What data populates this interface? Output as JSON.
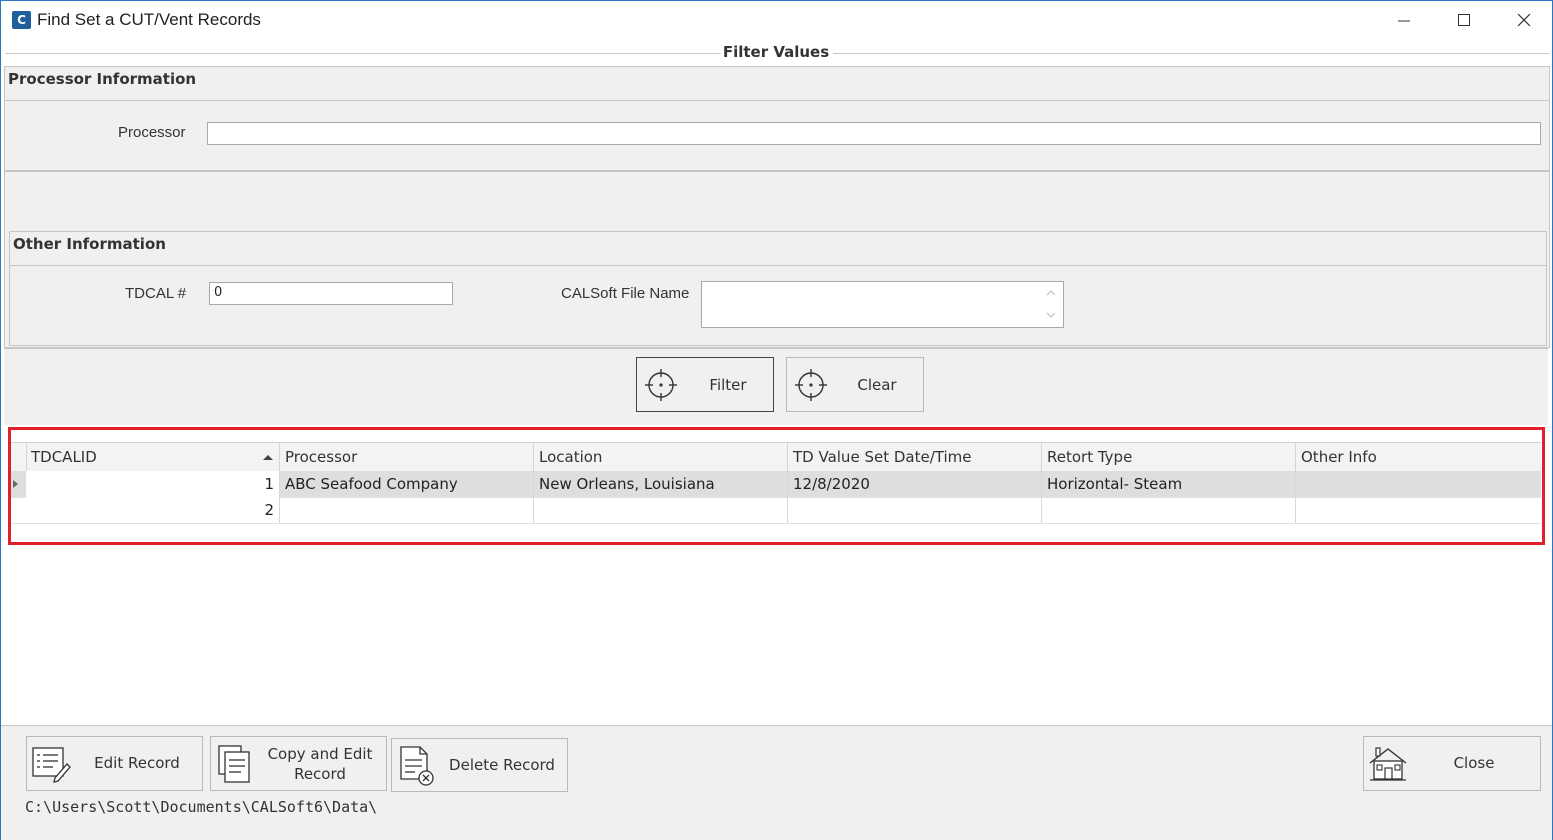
{
  "window": {
    "title": "Find Set a CUT/Vent Records",
    "app_icon_text": "C"
  },
  "filter_group": {
    "legend": "Filter Values"
  },
  "processor_section": {
    "heading": "Processor Information",
    "processor_label": "Processor",
    "processor_value": ""
  },
  "other_section": {
    "heading": "Other Information",
    "tdcal_label": "TDCAL #",
    "tdcal_value": "0",
    "calsoft_label": "CALSoft File Name",
    "calsoft_value": ""
  },
  "buttons": {
    "filter": "Filter",
    "clear": "Clear",
    "edit_record": "Edit Record",
    "copy_edit_line1": "Copy and Edit",
    "copy_edit_line2": "Record",
    "delete_record": "Delete Record",
    "close": "Close"
  },
  "grid": {
    "columns": [
      "TDCALID",
      "Processor",
      "Location",
      "TD Value Set Date/Time",
      "Retort Type",
      "Other Info"
    ],
    "sort_column": "TDCALID",
    "rows": [
      [
        "1",
        "ABC Seafood Company",
        "New Orleans, Louisiana",
        "12/8/2020",
        "Horizontal- Steam",
        ""
      ],
      [
        "2",
        "",
        "",
        "",
        "",
        ""
      ]
    ],
    "selected_row": 0,
    "highlight_color": "#e0202a"
  },
  "status": {
    "path": "C:\\Users\\Scott\\Documents\\CALSoft6\\Data\\"
  },
  "icons": [
    "app-icon",
    "minimize-icon",
    "maximize-icon",
    "close-icon",
    "crosshair-icon",
    "edit-list-icon",
    "copy-document-icon",
    "delete-document-icon",
    "house-icon",
    "sort-ascending-icon",
    "row-indicator-icon",
    "scroll-up-icon",
    "scroll-down-icon"
  ]
}
